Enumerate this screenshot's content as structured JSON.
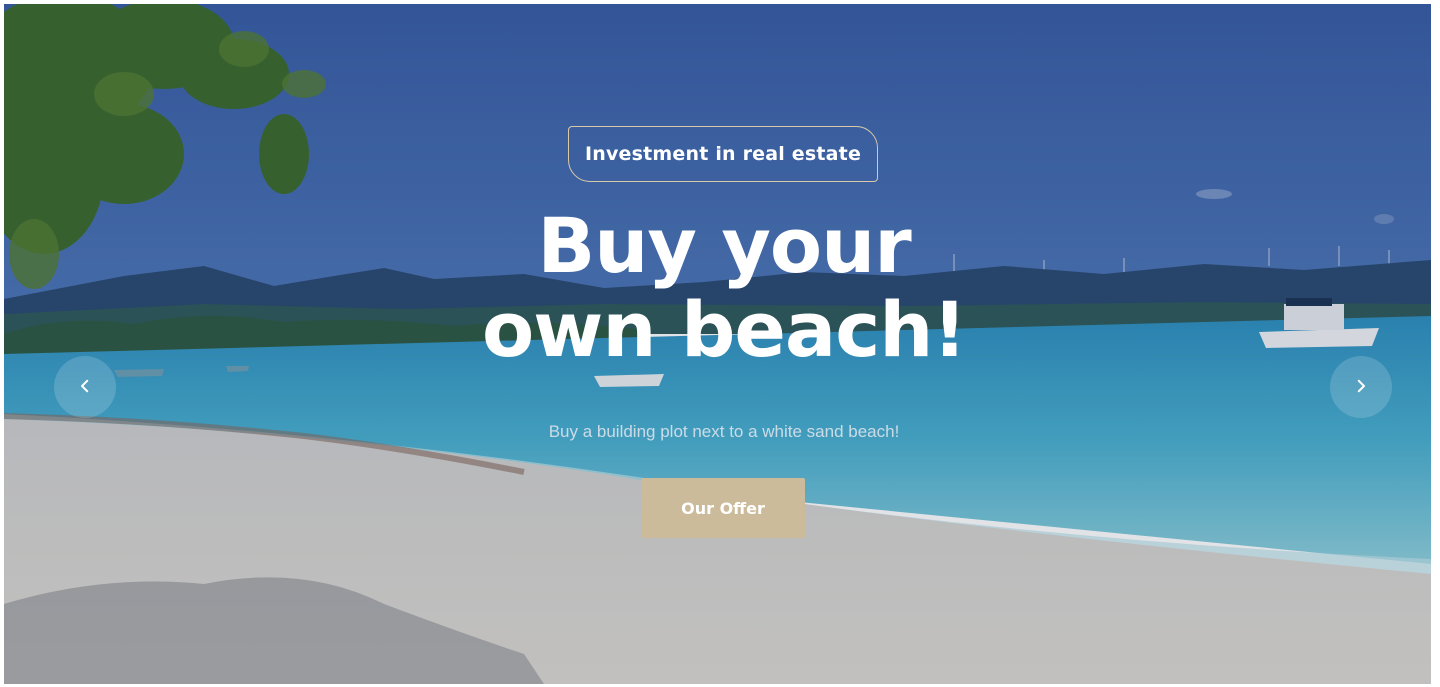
{
  "hero": {
    "tag": "Investment in real estate",
    "headline_line1": "Buy your",
    "headline_line2": "own beach!",
    "subtitle": "Buy a building plot next to a white sand beach!",
    "cta_label": "Our Offer"
  },
  "carousel": {
    "prev_icon": "chevron-left-icon",
    "next_icon": "chevron-right-icon"
  },
  "colors": {
    "accent": "#cbbb9b",
    "tag_border": "#d9c9a8",
    "sky": "#3f64a8",
    "sea": "#3aa0c4",
    "sand": "#d8d6d2"
  }
}
